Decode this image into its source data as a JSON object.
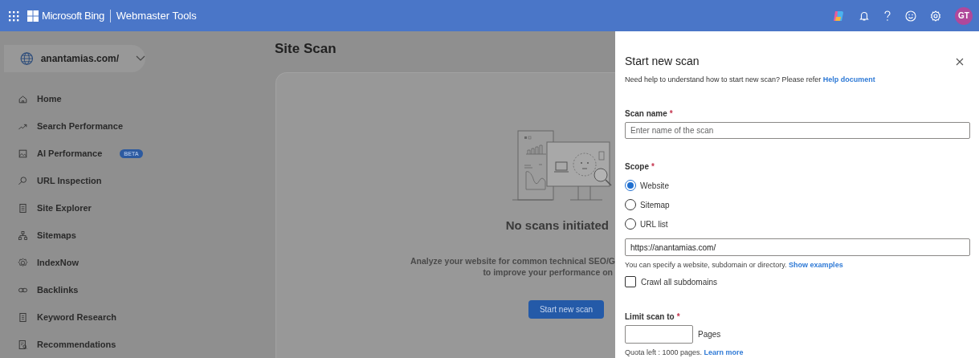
{
  "header": {
    "brand": "Microsoft Bing",
    "product": "Webmaster Tools",
    "avatar_initials": "GT"
  },
  "site_selector": {
    "label": "anantamias.com/"
  },
  "sidebar": {
    "items": [
      {
        "label": "Home"
      },
      {
        "label": "Search Performance"
      },
      {
        "label": "AI Performance",
        "badge": "BETA"
      },
      {
        "label": "URL Inspection"
      },
      {
        "label": "Site Explorer"
      },
      {
        "label": "Sitemaps"
      },
      {
        "label": "IndexNow"
      },
      {
        "label": "Backlinks"
      },
      {
        "label": "Keyword Research"
      },
      {
        "label": "Recommendations"
      }
    ]
  },
  "page_title": "Site Scan",
  "empty_state": {
    "heading": "No scans initiated",
    "description_lines": [
      "Analyze your website for common technical SEO/G",
      "to improve your performance on"
    ],
    "button": "Start new scan"
  },
  "panel": {
    "title": "Start new scan",
    "help_text": "Need help to understand how to start new scan? Please refer",
    "help_link": "Help document",
    "scan_name": {
      "label": "Scan name",
      "required_mark": "*",
      "placeholder": "Enter name of the scan"
    },
    "scope": {
      "label": "Scope",
      "required_mark": "*",
      "options": [
        {
          "label": "Website",
          "selected": true
        },
        {
          "label": "Sitemap",
          "selected": false
        },
        {
          "label": "URL list",
          "selected": false
        }
      ],
      "url_value": "https://anantamias.com/",
      "hint": "You can specify a website, subdomain or directory.",
      "hint_link": "Show examples"
    },
    "crawl_subdomains": {
      "label": "Crawl all subdomains",
      "checked": false
    },
    "limit": {
      "label": "Limit scan to",
      "required_mark": "*",
      "unit": "Pages",
      "quota": "Quota left : 1000 pages.",
      "quota_link": "Learn more"
    }
  }
}
